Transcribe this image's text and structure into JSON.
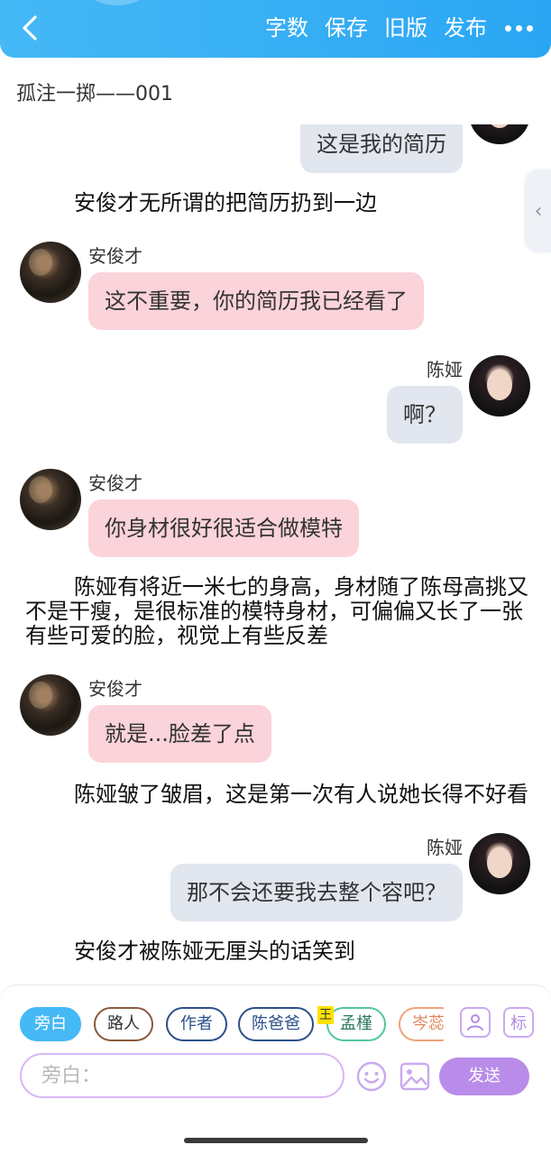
{
  "topbar": {
    "actions": [
      "字数",
      "保存",
      "旧版",
      "发布"
    ]
  },
  "chapter_title": "孤注一掷——001",
  "messages": [
    {
      "type": "right",
      "text": "这是我的简历"
    },
    {
      "type": "narration",
      "text": "安俊才无所谓的把简历扔到一边"
    },
    {
      "type": "left",
      "name": "安俊才",
      "text": "这不重要，你的简历我已经看了"
    },
    {
      "type": "right",
      "name": "陈娅",
      "text": "啊？"
    },
    {
      "type": "left",
      "name": "安俊才",
      "text": "你身材很好很适合做模特"
    },
    {
      "type": "narration",
      "text": "陈娅有将近一米七的身高，身材随了陈母高挑又不是干瘦，是很标准的模特身材，可偏偏又长了一张有些可爱的脸，视觉上有些反差"
    },
    {
      "type": "left",
      "name": "安俊才",
      "text": "就是...脸差了点"
    },
    {
      "type": "narration",
      "text": "陈娅皱了皱眉，这是第一次有人说她长得不好看"
    },
    {
      "type": "right",
      "name": "陈娅",
      "text": "那不会还要我去整个容吧？"
    },
    {
      "type": "narration",
      "text": "安俊才被陈娅无厘头的话笑到"
    }
  ],
  "roles": [
    "旁白",
    "路人",
    "作者",
    "陈爸爸",
    "孟槿",
    "岑蕊"
  ],
  "role_badge": "王",
  "tool_icons": [
    "person-icon",
    "tag-icon"
  ],
  "tag_label": "标",
  "input": {
    "placeholder": "旁白："
  },
  "send_label": "发送",
  "colors": {
    "topbar": "#45b8f6",
    "left_bubble": "#fbd3da",
    "right_bubble": "#e1e6ef",
    "send": "#b98ce9"
  }
}
